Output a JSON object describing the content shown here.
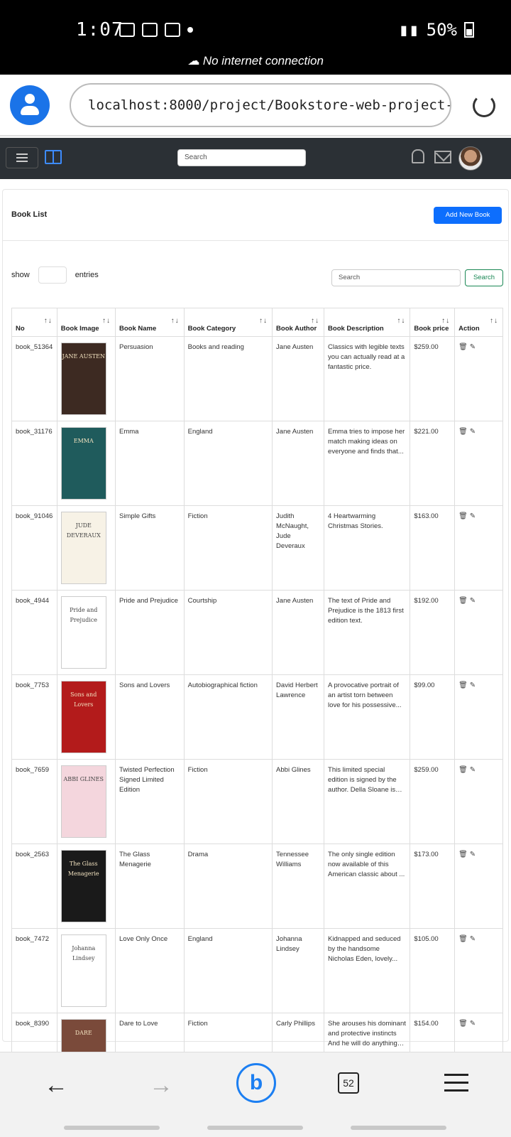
{
  "status_bar": {
    "time": "1:07",
    "battery": "50%",
    "network_message": "No internet connection"
  },
  "browser": {
    "url": "localhost:8000/project/Bookstore-web-project-main/",
    "tabs_count": "52"
  },
  "app_nav": {
    "search_placeholder": "Search"
  },
  "page": {
    "title": "Book List",
    "add_button": "Add New Book",
    "show_label": "show",
    "entries_label": "entries",
    "table_search_placeholder": "Search",
    "table_search_button": "Search"
  },
  "table": {
    "headers": [
      "No",
      "Book Image",
      "Book Name",
      "Book Category",
      "Book Author",
      "Book Description",
      "Book price",
      "Action"
    ],
    "rows": [
      {
        "no": "book_51364",
        "name": "Persuasion",
        "category": "Books and reading",
        "author": "Jane Austen",
        "description": "Classics with legible texts you can actually read at a fantastic price.",
        "price": "$259.00",
        "cover": {
          "bg": "#3d2a22",
          "text": "JANE AUSTEN"
        }
      },
      {
        "no": "book_31176",
        "name": "Emma",
        "category": "England",
        "author": "Jane Austen",
        "description": "Emma tries to impose her match making ideas on everyone and finds that...",
        "price": "$221.00",
        "cover": {
          "bg": "#1f5b5c",
          "text": "EMMA"
        }
      },
      {
        "no": "book_91046",
        "name": "Simple Gifts",
        "category": "Fiction",
        "author": "Judith McNaught, Jude Deveraux",
        "description": "4 Heartwarming Christmas Stories.",
        "price": "$163.00",
        "cover": {
          "bg": "#f7f2e6",
          "text": "JUDE DEVERAUX"
        }
      },
      {
        "no": "book_4944",
        "name": "Pride and Prejudice",
        "category": "Courtship",
        "author": "Jane Austen",
        "description": "The text of Pride and Prejudice is the 1813 first edition text.",
        "price": "$192.00",
        "cover": {
          "bg": "#ffffff",
          "text": "Pride and Prejudice"
        }
      },
      {
        "no": "book_7753",
        "name": "Sons and Lovers",
        "category": "Autobiographical fiction",
        "author": "David Herbert Lawrence",
        "description": "A provocative portrait of an artist torn between love for his possessive...",
        "price": "$99.00",
        "cover": {
          "bg": "#b31b1b",
          "text": "Sons and Lovers"
        }
      },
      {
        "no": "book_7659",
        "name": "Twisted Perfection Signed Limited Edition",
        "category": "Fiction",
        "author": "Abbi Glines",
        "description": "This limited special edition is signed by the author. Della Sloane is n...",
        "price": "$259.00",
        "cover": {
          "bg": "#f4d6dd",
          "text": "ABBI GLINES"
        }
      },
      {
        "no": "book_2563",
        "name": "The Glass Menagerie",
        "category": "Drama",
        "author": "Tennessee Williams",
        "description": "The only single edition now available of this American classic about ...",
        "price": "$173.00",
        "cover": {
          "bg": "#1a1a1a",
          "text": "The Glass Menagerie"
        }
      },
      {
        "no": "book_7472",
        "name": "Love Only Once",
        "category": "England",
        "author": "Johanna Lindsey",
        "description": "Kidnapped and seduced by the handsome Nicholas Eden, lovely...",
        "price": "$105.00",
        "cover": {
          "bg": "#ffffff",
          "text": "Johanna Lindsey"
        }
      },
      {
        "no": "book_8390",
        "name": "Dare to Love",
        "category": "Fiction",
        "author": "Carly Phillips",
        "description": "She arouses his dominant and protective instincts And he will do anything t...",
        "price": "$154.00",
        "cover": {
          "bg": "#7a4a3a",
          "text": "DARE"
        }
      }
    ]
  }
}
